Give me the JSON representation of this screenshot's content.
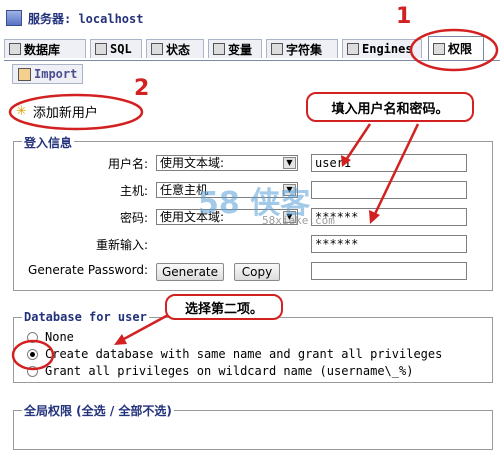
{
  "header": {
    "server_label": "服务器: localhost"
  },
  "tabs": [
    {
      "label": "数据库",
      "active": false
    },
    {
      "label": "SQL",
      "active": false
    },
    {
      "label": "状态",
      "active": false
    },
    {
      "label": "变量",
      "active": false
    },
    {
      "label": "字符集",
      "active": false
    },
    {
      "label": "Engines",
      "active": false
    },
    {
      "label": "权限",
      "active": true
    }
  ],
  "subtab": {
    "label": "Import"
  },
  "add_user": {
    "title": "添加新用户"
  },
  "login_info": {
    "legend": "登入信息",
    "username": {
      "label": "用户名:",
      "mode": "使用文本域:",
      "value": "user1"
    },
    "host": {
      "label": "主机:",
      "mode": "任意主机",
      "value": ""
    },
    "password": {
      "label": "密码:",
      "mode": "使用文本域:",
      "value": "******"
    },
    "retype": {
      "label": "重新输入:",
      "value": "******"
    },
    "generate": {
      "label": "Generate Password:",
      "generate_button": "Generate",
      "copy_button": "Copy",
      "value": ""
    }
  },
  "database": {
    "legend": "Database for user",
    "options": [
      {
        "label": "None",
        "selected": false
      },
      {
        "label": "Create database with same name and grant all privileges",
        "selected": true
      },
      {
        "label": "Grant all privileges on wildcard name (username\\_%)",
        "selected": false
      }
    ]
  },
  "global": {
    "legend": "全局权限 (全选 / 全部不选)"
  },
  "annotations": {
    "step1": "1",
    "step2": "2",
    "callout_credentials": "填入用户名和密码。",
    "callout_option": "选择第二项。"
  },
  "watermark": {
    "main": "58 侠客",
    "sub": "58xiake.com"
  },
  "colors": {
    "annotation": "#d32020",
    "legend": "#23327b"
  }
}
